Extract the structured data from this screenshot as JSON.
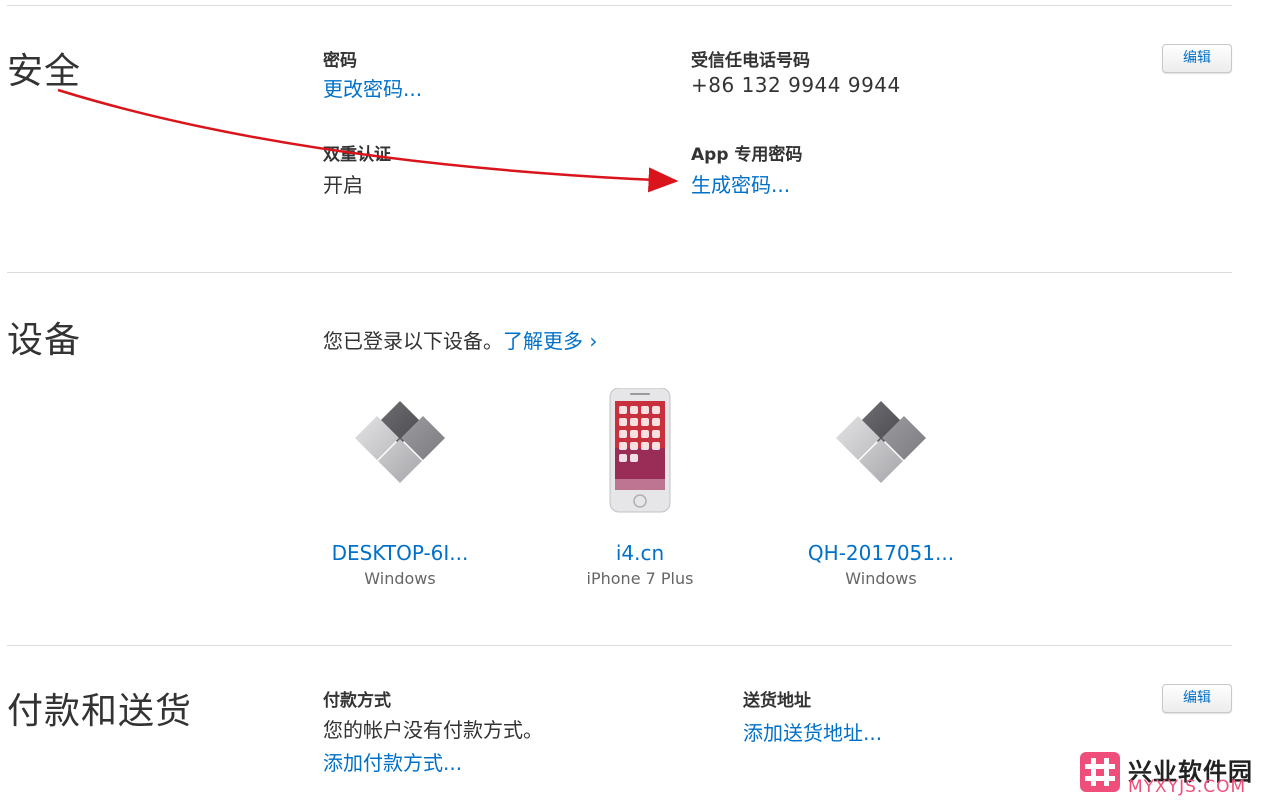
{
  "security": {
    "title": "安全",
    "password_label": "密码",
    "password_link": "更改密码...",
    "trusted_phone_label": "受信任电话号码",
    "trusted_phone_value": "+86 132 9944 9944",
    "two_factor_label": "双重认证",
    "two_factor_value": "开启",
    "app_password_label": "App 专用密码",
    "app_password_link": "生成密码...",
    "edit_label": "编辑",
    "annotation_arrow_color": "#d9141a"
  },
  "devices": {
    "title": "设备",
    "intro": "您已登录以下设备。",
    "learn_more": "了解更多 ›",
    "items": [
      {
        "name": "DESKTOP-6I...",
        "type": "Windows",
        "icon": "windows-logo-icon"
      },
      {
        "name": "i4.cn",
        "type": "iPhone 7 Plus",
        "icon": "iphone-icon"
      },
      {
        "name": "QH-2017051...",
        "type": "Windows",
        "icon": "windows-logo-icon"
      }
    ]
  },
  "payment": {
    "title": "付款和送货",
    "method_label": "付款方式",
    "method_value": "您的帐户没有付款方式。",
    "method_link": "添加付款方式...",
    "shipping_label": "送货地址",
    "shipping_link": "添加送货地址...",
    "edit_label": "编辑"
  },
  "watermark": {
    "cn": "兴业软件园",
    "en": "MYXYJS.COM",
    "icon": "hash-logo-icon"
  },
  "colors": {
    "link": "#0070c9",
    "text": "#333333",
    "muted": "#666666",
    "divider": "#dcdcdc",
    "watermark_accent": "#f04e7a"
  }
}
